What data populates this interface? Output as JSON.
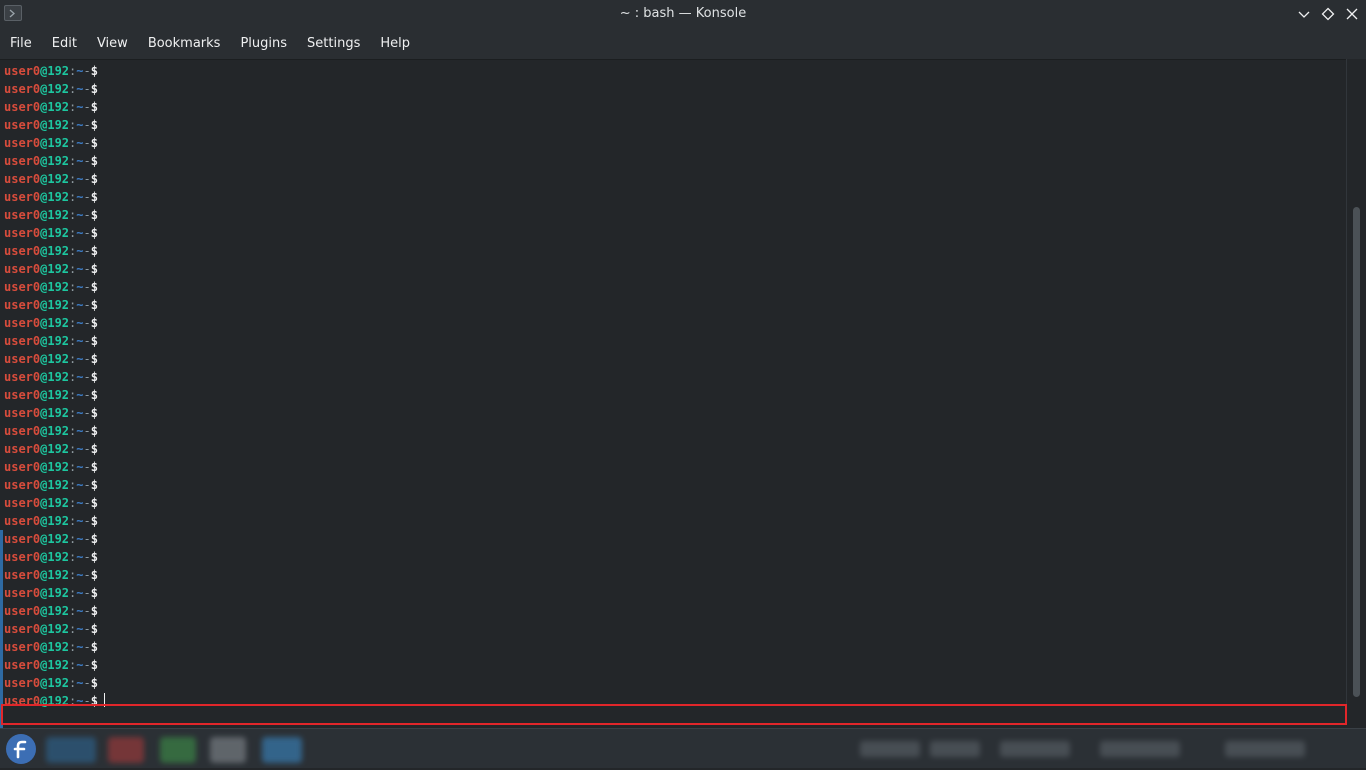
{
  "window": {
    "title": "~ : bash — Konsole"
  },
  "menubar": {
    "items": [
      "File",
      "Edit",
      "View",
      "Bookmarks",
      "Plugins",
      "Settings",
      "Help"
    ]
  },
  "terminal": {
    "prompt": {
      "user": "user0",
      "host": "@192",
      "colon": ":",
      "path": "~",
      "separator": "-",
      "symbol": "$"
    },
    "line_count": 36
  },
  "colors": {
    "background": "#232629",
    "prompt_user": "#d74c3c",
    "prompt_host": "#1dc7a0",
    "highlight_box": "#e1262a",
    "accent": "#2e6aa3"
  },
  "taskbar": {
    "launcher_icon": "fedora-logo-icon"
  }
}
